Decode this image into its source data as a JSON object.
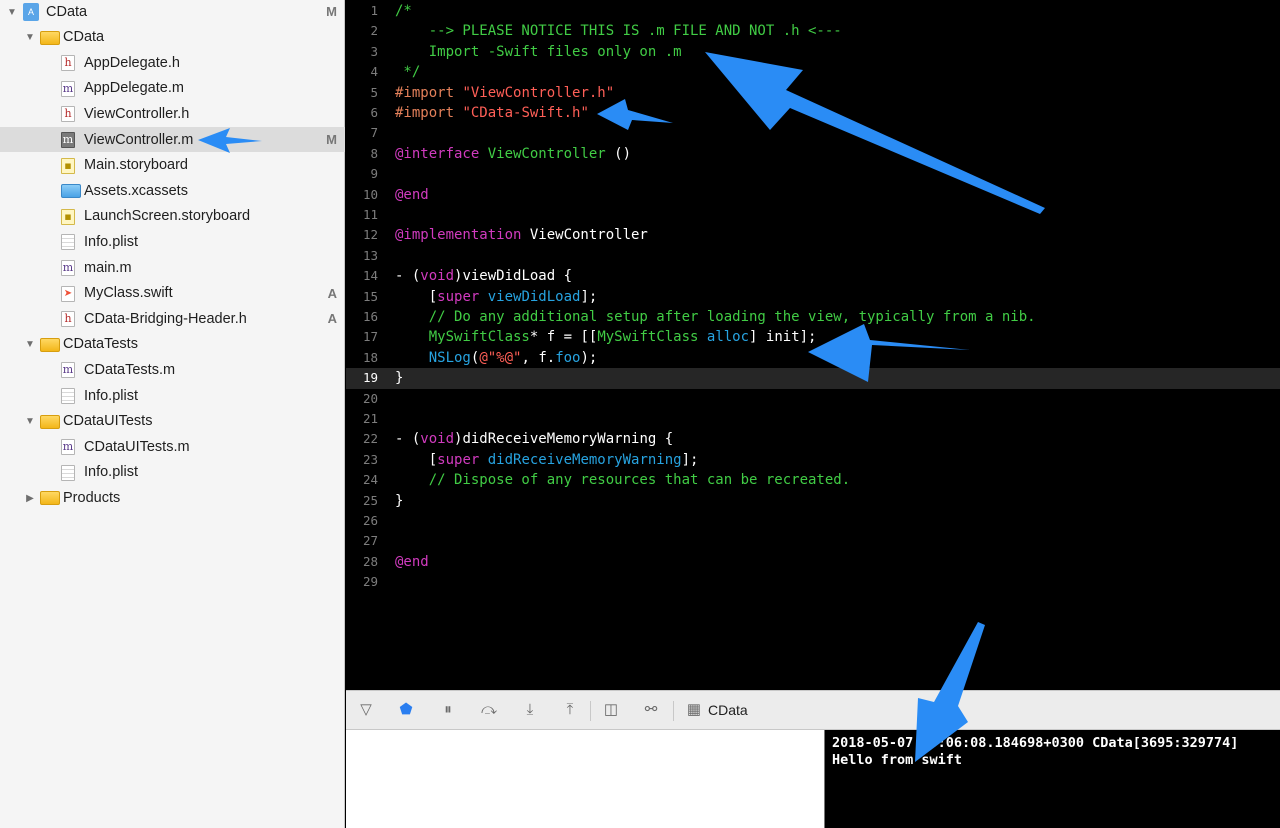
{
  "navigator": {
    "items": [
      {
        "label": "CData",
        "kind": "project",
        "indent": 0,
        "disclosure": "open",
        "badge": "M"
      },
      {
        "label": "CData",
        "kind": "folder",
        "indent": 1,
        "disclosure": "open",
        "badge": ""
      },
      {
        "label": "AppDelegate.h",
        "kind": "h",
        "indent": 2,
        "badge": ""
      },
      {
        "label": "AppDelegate.m",
        "kind": "m",
        "indent": 2,
        "badge": ""
      },
      {
        "label": "ViewController.h",
        "kind": "h",
        "indent": 2,
        "badge": ""
      },
      {
        "label": "ViewController.m",
        "kind": "m-selected",
        "indent": 2,
        "badge": "M",
        "selected": true
      },
      {
        "label": "Main.storyboard",
        "kind": "storyboard",
        "indent": 2,
        "badge": ""
      },
      {
        "label": "Assets.xcassets",
        "kind": "assets",
        "indent": 2,
        "badge": ""
      },
      {
        "label": "LaunchScreen.storyboard",
        "kind": "storyboard",
        "indent": 2,
        "badge": ""
      },
      {
        "label": "Info.plist",
        "kind": "plist",
        "indent": 2,
        "badge": ""
      },
      {
        "label": "main.m",
        "kind": "m",
        "indent": 2,
        "badge": ""
      },
      {
        "label": "MyClass.swift",
        "kind": "swift",
        "indent": 2,
        "badge": "A"
      },
      {
        "label": "CData-Bridging-Header.h",
        "kind": "h",
        "indent": 2,
        "badge": "A"
      },
      {
        "label": "CDataTests",
        "kind": "folder",
        "indent": 1,
        "disclosure": "open",
        "badge": ""
      },
      {
        "label": "CDataTests.m",
        "kind": "m",
        "indent": 2,
        "badge": ""
      },
      {
        "label": "Info.plist",
        "kind": "plist",
        "indent": 2,
        "badge": ""
      },
      {
        "label": "CDataUITests",
        "kind": "folder",
        "indent": 1,
        "disclosure": "open",
        "badge": ""
      },
      {
        "label": "CDataUITests.m",
        "kind": "m",
        "indent": 2,
        "badge": ""
      },
      {
        "label": "Info.plist",
        "kind": "plist",
        "indent": 2,
        "badge": ""
      },
      {
        "label": "Products",
        "kind": "folder",
        "indent": 1,
        "disclosure": "closed",
        "badge": ""
      }
    ]
  },
  "editor": {
    "current_line": 19,
    "lines": [
      [
        [
          "c-comment",
          "/*"
        ]
      ],
      [
        [
          "c-comment",
          "    --> PLEASE NOTICE THIS IS .m FILE AND NOT .h <---"
        ]
      ],
      [
        [
          "c-comment",
          "    Import -Swift files only on .m"
        ]
      ],
      [
        [
          "c-comment",
          " */"
        ]
      ],
      [
        [
          "c-pre",
          "#import "
        ],
        [
          "c-str",
          "\"ViewController.h\""
        ]
      ],
      [
        [
          "c-pre",
          "#import "
        ],
        [
          "c-str",
          "\"CData-Swift.h\""
        ]
      ],
      [],
      [
        [
          "c-kw",
          "@interface "
        ],
        [
          "c-cls",
          "ViewController"
        ],
        [
          "c-plain",
          " ()"
        ]
      ],
      [],
      [
        [
          "c-kw",
          "@end"
        ]
      ],
      [],
      [
        [
          "c-kw",
          "@implementation "
        ],
        [
          "c-plain",
          "ViewController"
        ]
      ],
      [],
      [
        [
          "c-plain",
          "- ("
        ],
        [
          "c-kw",
          "void"
        ],
        [
          "c-plain",
          ")viewDidLoad {"
        ]
      ],
      [
        [
          "c-plain",
          "    ["
        ],
        [
          "c-kw",
          "super "
        ],
        [
          "c-meth",
          "viewDidLoad"
        ],
        [
          "c-plain",
          "];"
        ]
      ],
      [
        [
          "c-comment",
          "    // Do any additional setup after loading the view, typically from a nib."
        ]
      ],
      [
        [
          "c-plain",
          "    "
        ],
        [
          "c-cls",
          "MySwiftClass"
        ],
        [
          "c-plain",
          "* f = [["
        ],
        [
          "c-cls",
          "MySwiftClass "
        ],
        [
          "c-meth",
          "alloc"
        ],
        [
          "c-plain",
          "] init];"
        ]
      ],
      [
        [
          "c-plain",
          "    "
        ],
        [
          "c-meth",
          "NSLog"
        ],
        [
          "c-plain",
          "("
        ],
        [
          "c-str",
          "@\"%@\""
        ],
        [
          "c-plain",
          ", f."
        ],
        [
          "c-meth",
          "foo"
        ],
        [
          "c-plain",
          ");"
        ]
      ],
      [
        [
          "c-plain",
          "}"
        ]
      ],
      [],
      [],
      [
        [
          "c-plain",
          "- ("
        ],
        [
          "c-kw",
          "void"
        ],
        [
          "c-plain",
          ")didReceiveMemoryWarning {"
        ]
      ],
      [
        [
          "c-plain",
          "    ["
        ],
        [
          "c-kw",
          "super "
        ],
        [
          "c-meth",
          "didReceiveMemoryWarning"
        ],
        [
          "c-plain",
          "];"
        ]
      ],
      [
        [
          "c-comment",
          "    // Dispose of any resources that can be recreated."
        ]
      ],
      [
        [
          "c-plain",
          "}"
        ]
      ],
      [],
      [],
      [
        [
          "c-kw",
          "@end"
        ]
      ],
      []
    ]
  },
  "debug_bar": {
    "buttons": [
      {
        "name": "hide-debug-area-button",
        "icon": "panel-toggle-icon",
        "glyph": "▽"
      },
      {
        "name": "breakpoints-toggle-button",
        "icon": "breakpoint-icon",
        "glyph": "⬟"
      },
      {
        "name": "pause-button",
        "icon": "pause-icon",
        "glyph": "⏸"
      },
      {
        "name": "step-over-button",
        "icon": "step-over-icon",
        "glyph": "⤼"
      },
      {
        "name": "step-into-button",
        "icon": "step-into-icon",
        "glyph": "⤓"
      },
      {
        "name": "step-out-button",
        "icon": "step-out-icon",
        "glyph": "⤒"
      },
      {
        "name": "view-debugger-button",
        "icon": "view-hierarchy-icon",
        "glyph": "◫"
      },
      {
        "name": "memory-graph-button",
        "icon": "memory-graph-icon",
        "glyph": "⚯"
      }
    ],
    "target_icon": "target-icon",
    "target_label": "CData"
  },
  "console": {
    "lines": [
      "2018-05-07 15:06:08.184698+0300 CData[3695:329774]",
      "Hello from swift"
    ]
  },
  "colors": {
    "arrow": "#2a8cf5",
    "editor_bg": "#000000",
    "navigator_bg": "#f5f5f5"
  }
}
